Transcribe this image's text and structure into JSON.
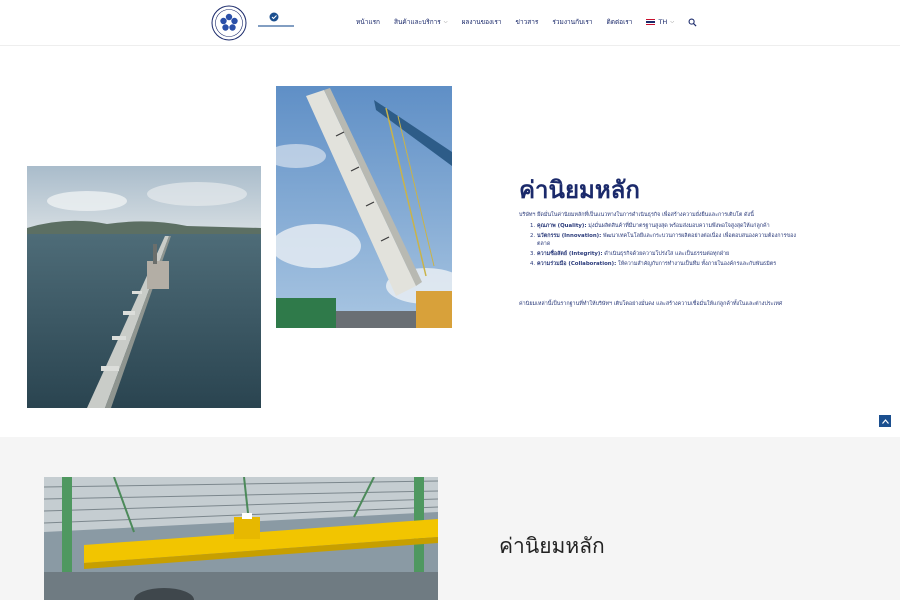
{
  "header": {
    "nav": [
      {
        "label": "หน้าแรก",
        "dropdown": false
      },
      {
        "label": "สินค้าและบริการ",
        "dropdown": true
      },
      {
        "label": "ผลงานของเรา",
        "dropdown": false
      },
      {
        "label": "ข่าวสาร",
        "dropdown": false
      },
      {
        "label": "ร่วมงานกับเรา",
        "dropdown": false
      },
      {
        "label": "ติดต่อเรา",
        "dropdown": false
      }
    ],
    "language": "TH",
    "search_icon": "search-icon"
  },
  "section1": {
    "title": "ค่านิยมหลัก",
    "intro": "บริษัทฯ ยึดมั่นในค่านิยมหลักที่เป็นแนวทางในการดำเนินธุรกิจ เพื่อสร้างความยั่งยืนและการเติบโต ดังนี้",
    "values": [
      {
        "num": "1.",
        "name": "คุณภาพ (Quality):",
        "text": " มุ่งมั่นผลิตสินค้าที่มีมาตรฐานสูงสุด พร้อมส่งมอบความพึงพอใจสูงสุดให้แก่ลูกค้า"
      },
      {
        "num": "2.",
        "name": "นวัตกรรม (Innovation):",
        "text": " พัฒนาเทคโนโลยีและกระบวนการผลิตอย่างต่อเนื่อง เพื่อตอบสนองความต้องการของตลาด"
      },
      {
        "num": "3.",
        "name": "ความซื่อสัตย์ (Integrity):",
        "text": " ดำเนินธุรกิจด้วยความโปร่งใส และเป็นธรรมต่อทุกฝ่าย"
      },
      {
        "num": "4.",
        "name": "ความร่วมมือ (Collaboration):",
        "text": " ให้ความสำคัญกับการทำงานเป็นทีม ทั้งภายในองค์กรและกับพันธมิตร"
      }
    ],
    "outro": "ค่านิยมเหล่านี้เป็นรากฐานที่ทำให้บริษัทฯ เติบโตอย่างมั่นคง และสร้างความเชื่อมั่นให้แก่ลูกค้าทั้งในและต่างประเทศ"
  },
  "section2": {
    "title": "ค่านิยมหลัก"
  },
  "colors": {
    "primary": "#1b2a6b",
    "accent_yellow": "#f2c500",
    "back_to_top": "#1b4f8f",
    "section_bg": "#f5f5f5"
  }
}
